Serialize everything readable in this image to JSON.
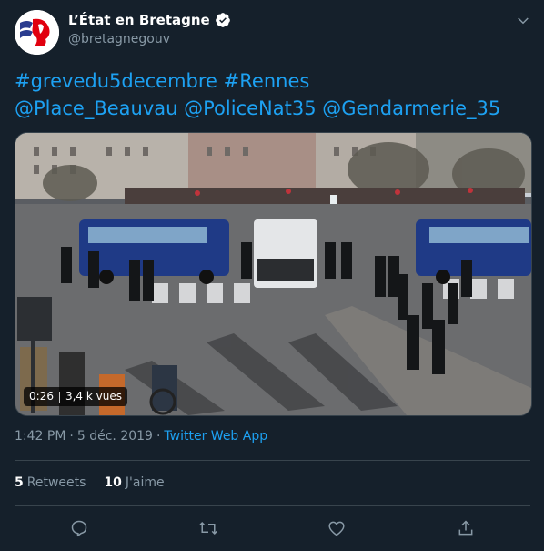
{
  "author": {
    "name": "L’État en Bretagne",
    "handle": "@bretagnegouv",
    "verified": true
  },
  "tweet": {
    "hashtags": [
      "#grevedu5decembre",
      "#Rennes"
    ],
    "mentions": [
      "@Place_Beauvau",
      "@PoliceNat35",
      "@Gendarmerie_35"
    ]
  },
  "video": {
    "duration": "0:26",
    "views": "3,4 k vues"
  },
  "meta": {
    "time": "1:42 PM",
    "separator": "·",
    "date": "5 déc. 2019",
    "app": "Twitter Web App"
  },
  "stats": {
    "retweets_count": "5",
    "retweets_label": "Retweets",
    "likes_count": "10",
    "likes_label": "J'aime"
  },
  "icons": {
    "more": "chevron-down-icon",
    "verified": "verified-badge-icon",
    "reply": "reply-icon",
    "retweet": "retweet-icon",
    "like": "like-icon",
    "share": "share-icon"
  },
  "colors": {
    "background": "#15202b",
    "link": "#1da1f2",
    "secondary_text": "#8899a6",
    "divider": "#38444d"
  }
}
